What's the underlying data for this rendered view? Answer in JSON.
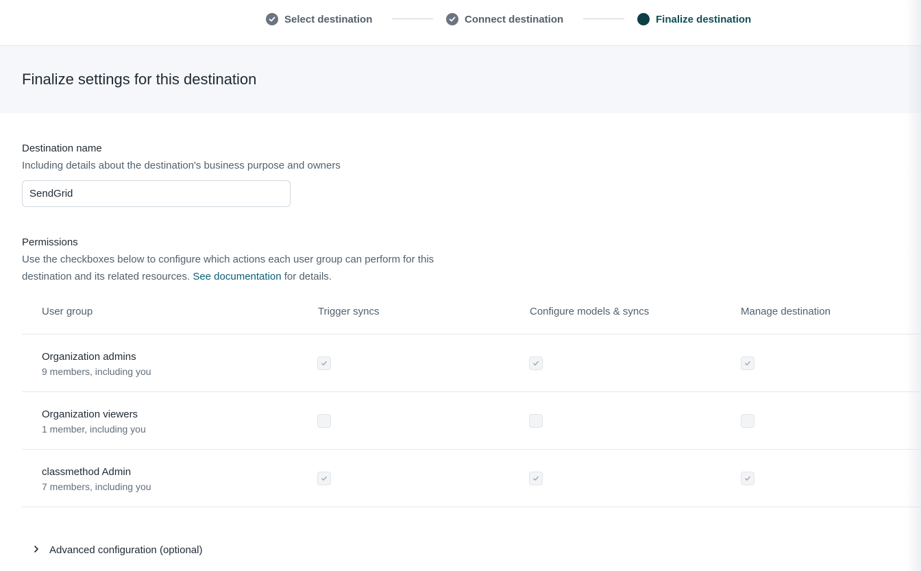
{
  "stepper": {
    "steps": [
      {
        "label": "Select destination",
        "state": "completed"
      },
      {
        "label": "Connect destination",
        "state": "completed"
      },
      {
        "label": "Finalize destination",
        "state": "active"
      }
    ]
  },
  "page": {
    "title": "Finalize settings for this destination"
  },
  "destination_name": {
    "label": "Destination name",
    "help": "Including details about the destination's business purpose and owners",
    "value": "SendGrid"
  },
  "permissions": {
    "label": "Permissions",
    "help_line1": "Use the checkboxes below to configure which actions each user group can perform for this",
    "help_line2_pre": "destination and its related resources.",
    "help_link": "See documentation",
    "help_line2_post": "for details.",
    "columns": [
      "User group",
      "Trigger syncs",
      "Configure models & syncs",
      "Manage destination"
    ],
    "rows": [
      {
        "name": "Organization admins",
        "members": "9 members, including you",
        "trigger": true,
        "configure": true,
        "manage": true
      },
      {
        "name": "Organization viewers",
        "members": "1 member, including you",
        "trigger": false,
        "configure": false,
        "manage": false
      },
      {
        "name": "classmethod Admin",
        "members": "7 members, including you",
        "trigger": true,
        "configure": true,
        "manage": true
      }
    ]
  },
  "advanced": {
    "label": "Advanced configuration (optional)",
    "icon": "chevron-right-icon"
  },
  "colors": {
    "accent": "#0d3f44",
    "link": "#0b5e72",
    "band": "#f5f7fa"
  }
}
